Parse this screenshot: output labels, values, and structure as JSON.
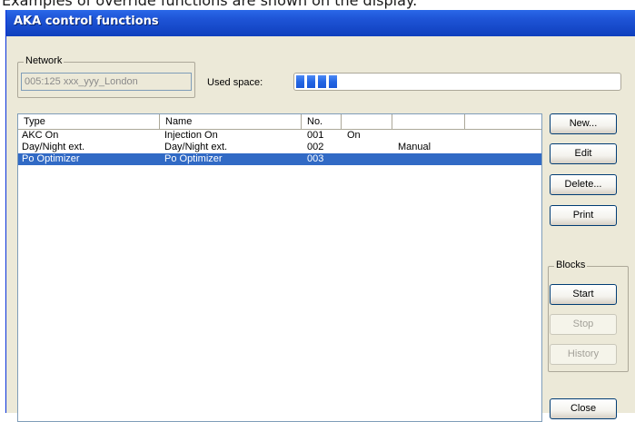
{
  "caption": "Examples of override functions are shown on the display.",
  "window": {
    "title": "AKA control functions"
  },
  "network": {
    "group_label": "Network",
    "value": "005:125  xxx_yyy_London"
  },
  "used_space": {
    "label": "Used space:",
    "fraction": 0.1
  },
  "list": {
    "columns": [
      "Type",
      "Name",
      "No.",
      "",
      "",
      ""
    ],
    "rows": [
      {
        "type": "AKC On",
        "name": "Injection On",
        "no": "001",
        "c4": "On",
        "c5": "",
        "selected": false
      },
      {
        "type": "Day/Night ext.",
        "name": "Day/Night ext.",
        "no": "002",
        "c4": "",
        "c5": "Manual",
        "selected": false
      },
      {
        "type": "Po Optimizer",
        "name": "Po Optimizer",
        "no": "003",
        "c4": "",
        "c5": "",
        "selected": true
      }
    ]
  },
  "buttons": {
    "new": "New...",
    "edit": "Edit",
    "delete": "Delete...",
    "print": "Print",
    "close": "Close"
  },
  "blocks": {
    "group_label": "Blocks",
    "start": "Start",
    "stop": "Stop",
    "history": "History"
  },
  "colors": {
    "title_bar": "#1e54d6",
    "selection": "#316ac5",
    "progress": "#2466e3"
  }
}
